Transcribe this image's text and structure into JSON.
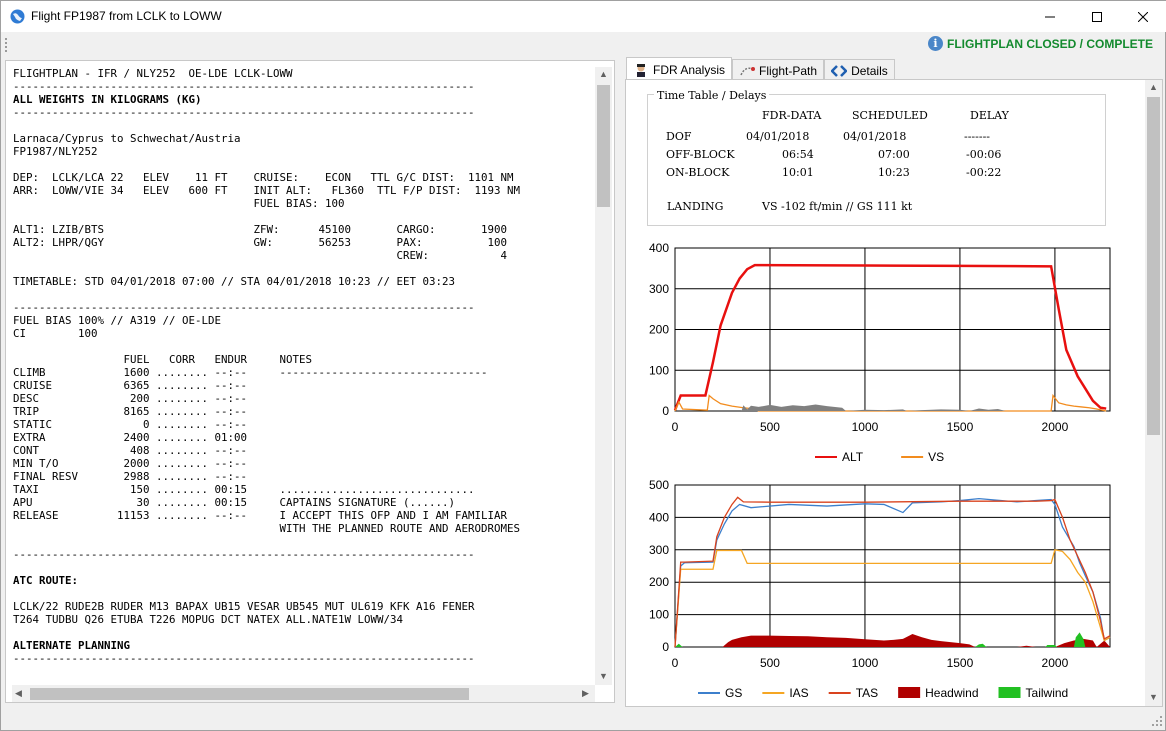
{
  "window": {
    "title": "Flight FP1987 from LCLK to LOWW",
    "minimize_glyph": "—",
    "maximize_glyph": "☐",
    "close_glyph": "✕"
  },
  "status": {
    "icon": "info-icon",
    "icon_glyph": "i",
    "text": "FLIGHTPLAN CLOSED / COMPLETE",
    "color": "#138a2e"
  },
  "ofp": {
    "lines": [
      {
        "text": "FLIGHTPLAN - IFR / NLY252  OE-LDE LCLK-LOWW",
        "bold": false
      },
      {
        "text": "-----------------------------------------------------------------------",
        "bold": false
      },
      {
        "text": "ALL WEIGHTS IN KILOGRAMS (KG)",
        "bold": true
      },
      {
        "text": "-----------------------------------------------------------------------",
        "bold": false
      },
      {
        "text": "",
        "bold": false
      },
      {
        "text": "Larnaca/Cyprus to Schwechat/Austria",
        "bold": false
      },
      {
        "text": "FP1987/NLY252",
        "bold": false
      },
      {
        "text": "",
        "bold": false
      },
      {
        "text": "DEP:  LCLK/LCA 22   ELEV    11 FT    CRUISE:    ECON   TTL G/C DIST:  1101 NM",
        "bold": false
      },
      {
        "text": "ARR:  LOWW/VIE 34   ELEV   600 FT    INIT ALT:   FL360  TTL F/P DIST:  1193 NM",
        "bold": false
      },
      {
        "text": "                                     FUEL BIAS: 100",
        "bold": false
      },
      {
        "text": "",
        "bold": false
      },
      {
        "text": "ALT1: LZIB/BTS                       ZFW:      45100       CARGO:       1900",
        "bold": false
      },
      {
        "text": "ALT2: LHPR/QGY                       GW:       56253       PAX:          100",
        "bold": false
      },
      {
        "text": "                                                           CREW:           4",
        "bold": false
      },
      {
        "text": "",
        "bold": false
      },
      {
        "text": "TIMETABLE: STD 04/01/2018 07:00 // STA 04/01/2018 10:23 // EET 03:23",
        "bold": false
      },
      {
        "text": "",
        "bold": false
      },
      {
        "text": "-----------------------------------------------------------------------",
        "bold": false
      },
      {
        "text": "FUEL BIAS 100% // A319 // OE-LDE",
        "bold": false
      },
      {
        "text": "CI        100",
        "bold": false
      },
      {
        "text": "",
        "bold": false
      },
      {
        "text": "                 FUEL   CORR   ENDUR     NOTES",
        "bold": false
      },
      {
        "text": "CLIMB            1600 ........ --:--     --------------------------------",
        "bold": false
      },
      {
        "text": "CRUISE           6365 ........ --:--",
        "bold": false
      },
      {
        "text": "DESC              200 ........ --:--",
        "bold": false
      },
      {
        "text": "TRIP             8165 ........ --:--",
        "bold": false
      },
      {
        "text": "STATIC              0 ........ --:--",
        "bold": false
      },
      {
        "text": "EXTRA            2400 ........ 01:00",
        "bold": false
      },
      {
        "text": "CONT              408 ........ --:--",
        "bold": false
      },
      {
        "text": "MIN T/O          2000 ........ --:--",
        "bold": false
      },
      {
        "text": "FINAL RESV       2988 ........ --:--",
        "bold": false
      },
      {
        "text": "TAXI              150 ........ 00:15     ..............................",
        "bold": false
      },
      {
        "text": "APU                30 ........ 00:15     CAPTAINS SIGNATURE (......)",
        "bold": false
      },
      {
        "text": "RELEASE         11153 ........ --:--     I ACCEPT THIS OFP AND I AM FAMILIAR",
        "bold": false
      },
      {
        "text": "                                         WITH THE PLANNED ROUTE AND AERODROMES",
        "bold": false
      },
      {
        "text": "",
        "bold": false
      },
      {
        "text": "-----------------------------------------------------------------------",
        "bold": false
      },
      {
        "text": "",
        "bold": false
      },
      {
        "text": "ATC ROUTE:",
        "bold": true
      },
      {
        "text": "",
        "bold": false
      },
      {
        "text": "LCLK/22 RUDE2B RUDER M13 BAPAX UB15 VESAR UB545 MUT UL619 KFK A16 FENER",
        "bold": false
      },
      {
        "text": "T264 TUDBU Q26 ETUBA T226 MOPUG DCT NATEX ALL.NATE1W LOWW/34",
        "bold": false
      },
      {
        "text": "",
        "bold": false
      },
      {
        "text": "ALTERNATE PLANNING",
        "bold": true
      },
      {
        "text": "-----------------------------------------------------------------------",
        "bold": false
      }
    ]
  },
  "tabs": [
    {
      "label": "FDR Analysis",
      "icon": "pilot-icon",
      "active": true
    },
    {
      "label": "Flight-Path",
      "icon": "path-icon",
      "active": false
    },
    {
      "label": "Details",
      "icon": "code-icon",
      "active": false
    }
  ],
  "timetable": {
    "title": "Time Table / Delays",
    "headers": [
      "FDR-DATA",
      "SCHEDULED",
      "DELAY"
    ],
    "rows": [
      {
        "label": "DOF",
        "fdr": "04/01/2018",
        "scheduled": "04/01/2018",
        "delay": "-------"
      },
      {
        "label": "OFF-BLOCK",
        "fdr": "06:54",
        "scheduled": "07:00",
        "delay": "-00:06"
      },
      {
        "label": "ON-BLOCK",
        "fdr": "10:01",
        "scheduled": "10:23",
        "delay": "-00:22"
      }
    ],
    "landing_label": "LANDING",
    "landing_value": "VS -102 ft/min // GS 111 kt"
  },
  "chart_data": [
    {
      "type": "line",
      "xlim": [
        0,
        2290
      ],
      "ylim": [
        0,
        400
      ],
      "xticks": [
        0,
        500,
        1000,
        1500,
        2000
      ],
      "yticks": [
        0,
        100,
        200,
        300,
        400
      ],
      "grid": true,
      "legend": "bottom",
      "series": [
        {
          "name": "ALT",
          "color": "#e8100f",
          "x": [
            0,
            30,
            160,
            200,
            240,
            300,
            340,
            380,
            420,
            1000,
            1500,
            1980,
            2020,
            2060,
            2120,
            2160,
            2200,
            2240,
            2270
          ],
          "y": [
            2,
            38,
            38,
            120,
            210,
            290,
            325,
            348,
            358,
            357,
            356,
            355,
            250,
            150,
            85,
            55,
            25,
            8,
            6
          ]
        },
        {
          "name": "VS",
          "color": "#f28c1e",
          "x": [
            0,
            20,
            40,
            170,
            180,
            200,
            240,
            300,
            360,
            420,
            440,
            1000,
            1500,
            1950,
            1980,
            1990,
            2020,
            2060,
            2100,
            2140,
            2180,
            2220,
            2270
          ],
          "y": [
            0,
            22,
            5,
            2,
            38,
            30,
            18,
            12,
            8,
            5,
            0,
            0,
            0,
            0,
            0,
            38,
            20,
            15,
            12,
            10,
            8,
            5,
            0
          ]
        },
        {
          "name": "Ground",
          "color": "#808080",
          "legend": false,
          "x": [
            0,
            350,
            360,
            380,
            400,
            440,
            500,
            560,
            620,
            680,
            740,
            800,
            880,
            900,
            1000,
            1100,
            1200,
            1220,
            1300,
            1400,
            1500,
            1550,
            1600,
            1650,
            1700,
            1740,
            2000,
            2290
          ],
          "y": [
            0,
            0,
            14,
            4,
            13,
            10,
            15,
            10,
            14,
            12,
            16,
            12,
            8,
            0,
            3,
            2,
            4,
            0,
            2,
            4,
            3,
            0,
            6,
            3,
            5,
            0,
            0,
            0
          ]
        }
      ]
    },
    {
      "type": "line",
      "xlim": [
        0,
        2290
      ],
      "ylim": [
        0,
        500
      ],
      "xticks": [
        0,
        500,
        1000,
        1500,
        2000
      ],
      "yticks": [
        0,
        100,
        200,
        300,
        400,
        500
      ],
      "grid": true,
      "legend": "bottom",
      "series": [
        {
          "name": "GS",
          "color": "#3c7fcc",
          "x": [
            0,
            30,
            50,
            200,
            220,
            260,
            300,
            340,
            400,
            600,
            800,
            1000,
            1100,
            1200,
            1250,
            1400,
            1500,
            1600,
            1800,
            1900,
            1980,
            2000,
            2040,
            2060,
            2100,
            2130,
            2160,
            2200,
            2240,
            2260,
            2290
          ],
          "y": [
            0,
            250,
            260,
            262,
            330,
            380,
            420,
            440,
            430,
            440,
            435,
            442,
            440,
            415,
            445,
            448,
            452,
            458,
            448,
            452,
            455,
            440,
            370,
            350,
            310,
            260,
            220,
            170,
            90,
            20,
            30
          ]
        },
        {
          "name": "IAS",
          "color": "#f5a623",
          "x": [
            0,
            30,
            50,
            200,
            220,
            240,
            350,
            380,
            1000,
            1500,
            1980,
            2000,
            2040,
            2080,
            2120,
            2160,
            2200,
            2240,
            2260,
            2290
          ],
          "y": [
            0,
            240,
            240,
            240,
            298,
            298,
            298,
            258,
            258,
            258,
            258,
            300,
            295,
            270,
            230,
            200,
            140,
            60,
            20,
            30
          ]
        },
        {
          "name": "TAS",
          "color": "#d9431e",
          "x": [
            0,
            30,
            50,
            200,
            220,
            260,
            300,
            330,
            360,
            500,
            1000,
            1500,
            1900,
            1980,
            2000,
            2040,
            2080,
            2120,
            2160,
            2200,
            2240,
            2260,
            2290
          ],
          "y": [
            0,
            262,
            262,
            265,
            340,
            400,
            440,
            462,
            448,
            447,
            447,
            450,
            450,
            452,
            455,
            400,
            330,
            280,
            230,
            170,
            80,
            25,
            35
          ]
        },
        {
          "name": "Headwind",
          "color": "#b00000",
          "kind": "area",
          "x": [
            0,
            250,
            280,
            300,
            350,
            400,
            500,
            600,
            700,
            800,
            900,
            1000,
            1100,
            1150,
            1200,
            1250,
            1300,
            1350,
            1400,
            1500,
            1550,
            1580,
            1620,
            1700,
            1800,
            1850,
            1900,
            2000,
            2050,
            2100,
            2150,
            2200,
            2220,
            2260,
            2290
          ],
          "y": [
            0,
            0,
            15,
            22,
            30,
            35,
            35,
            34,
            33,
            30,
            28,
            24,
            20,
            22,
            25,
            40,
            30,
            22,
            18,
            12,
            8,
            0,
            0,
            0,
            0,
            4,
            0,
            0,
            12,
            20,
            25,
            20,
            0,
            20,
            0
          ]
        },
        {
          "name": "Tailwind",
          "color": "#22c022",
          "kind": "area",
          "x": [
            0,
            20,
            40,
            60,
            1580,
            1600,
            1620,
            1640,
            1950,
            1960,
            2000,
            2010,
            2100,
            2110,
            2130,
            2150,
            2160,
            2290
          ],
          "y": [
            0,
            10,
            0,
            0,
            0,
            8,
            10,
            0,
            0,
            6,
            6,
            0,
            0,
            30,
            45,
            25,
            0,
            0
          ]
        }
      ]
    }
  ]
}
